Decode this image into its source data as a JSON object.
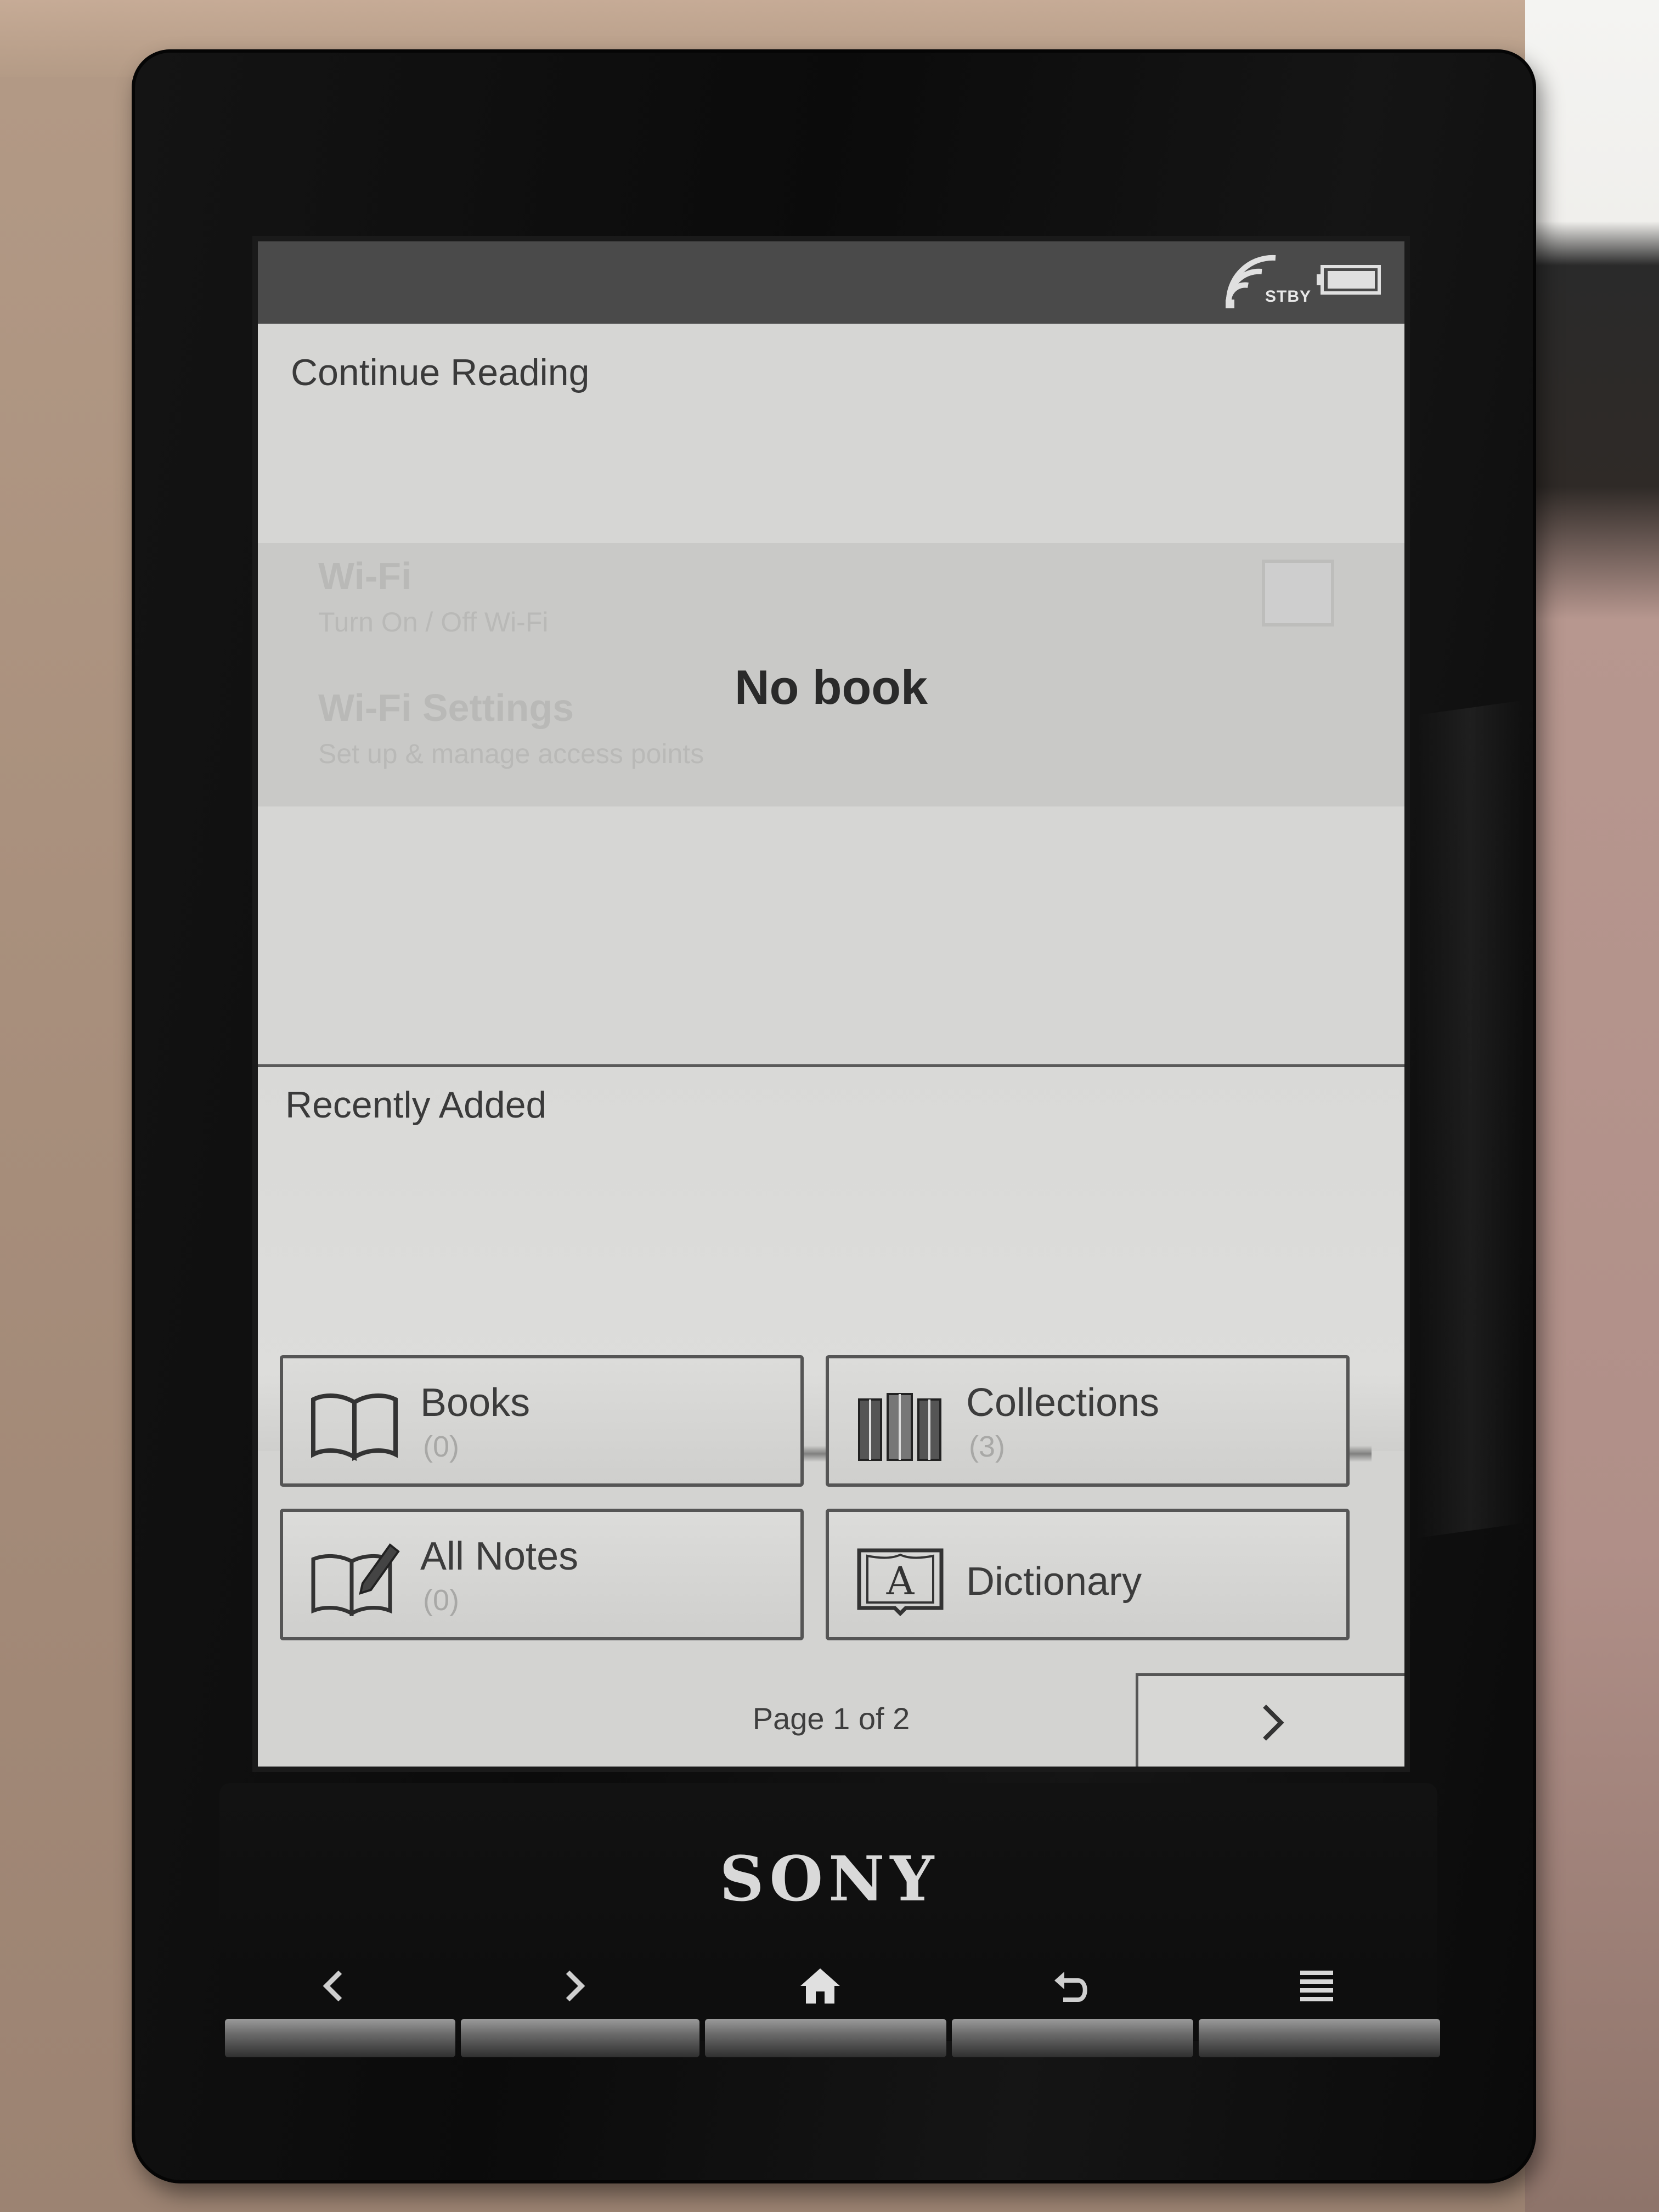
{
  "device": {
    "brand": "SONY"
  },
  "status_bar": {
    "standby_label": "STBY",
    "wifi_icon": "wifi-signal-icon",
    "battery_icon": "battery-icon"
  },
  "continue_reading": {
    "title": "Continue Reading",
    "empty_message": "No book"
  },
  "ghost_overlay": {
    "wifi_title": "Wi-Fi",
    "wifi_subtitle": "Turn On / Off Wi-Fi",
    "wifi_settings_title": "Wi-Fi Settings",
    "wifi_settings_subtitle": "Set up & manage access points"
  },
  "recently_added": {
    "title": "Recently Added"
  },
  "tiles": [
    {
      "label": "Books",
      "count": "(0)",
      "icon": "book-icon"
    },
    {
      "label": "Collections",
      "count": "(3)",
      "icon": "collections-icon"
    },
    {
      "label": "All Notes",
      "count": "(0)",
      "icon": "notes-icon"
    },
    {
      "label": "Dictionary",
      "count": "",
      "icon": "dictionary-icon"
    }
  ],
  "pager": {
    "text": "Page 1 of 2",
    "next_icon": "chevron-right-icon"
  },
  "hardware_buttons": [
    {
      "icon": "chevron-left-icon"
    },
    {
      "icon": "chevron-right-icon"
    },
    {
      "icon": "home-icon"
    },
    {
      "icon": "back-icon"
    },
    {
      "icon": "menu-icon"
    }
  ],
  "colors": {
    "screen_bg": "#d3d3d1",
    "status_bar_bg": "#4a4a4a",
    "device_body": "#0d0d0d"
  }
}
